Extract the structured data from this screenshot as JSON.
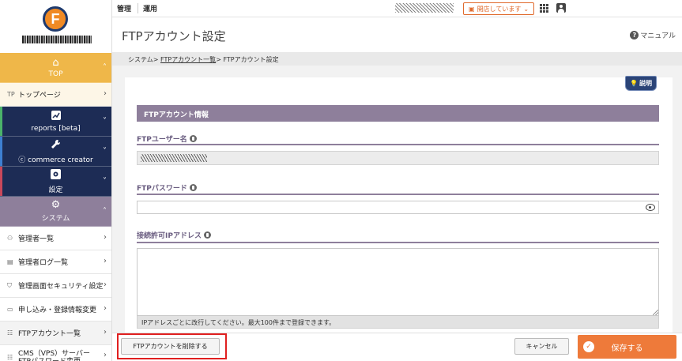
{
  "topbar": {
    "menu": [
      "管理",
      "運用"
    ],
    "shop_status": "開店しています",
    "chevron": "⌄"
  },
  "sidebar": {
    "top": {
      "label": "TOP",
      "icon": "home-icon"
    },
    "top_page": {
      "prefix": "TP",
      "label": "トップページ"
    },
    "reports": {
      "label": "reports [beta]",
      "icon": "chart-icon"
    },
    "commerce_creator": {
      "label": "commerce creator",
      "icon": "wrench-icon"
    },
    "settings": {
      "label": "設定",
      "icon": "settings-icon"
    },
    "system": {
      "label": "システム",
      "icon": "gear-icon"
    },
    "system_items": [
      {
        "label": "管理者一覧",
        "icon": "users-icon"
      },
      {
        "label": "管理者ログ一覧",
        "icon": "log-icon"
      },
      {
        "label": "管理画面セキュリティ設定",
        "icon": "shield-icon"
      },
      {
        "label": "申し込み・登録情報変更",
        "icon": "card-icon"
      },
      {
        "label": "FTPアカウント一覧",
        "icon": "server-icon"
      },
      {
        "label": "CMS（VPS）サーバー FTPパスワード変更",
        "icon": "server-icon"
      }
    ]
  },
  "header": {
    "title": "FTPアカウント設定",
    "manual": "マニュアル"
  },
  "breadcrumb": {
    "root": "システム",
    "sep": ">",
    "link": "FTPアカウント一覧",
    "current": "FTPアカウント設定"
  },
  "form": {
    "help_label": "説明",
    "section_title": "FTPアカウント情報",
    "username_label": "FTPユーザー名",
    "password_label": "FTPパスワード",
    "ip_label": "接続許可IPアドレス",
    "ip_hint": "IPアドレスごとに改行してください。最大100件まで登録できます。"
  },
  "footer": {
    "delete": "FTPアカウントを削除する",
    "cancel": "キャンセル",
    "save": "保存する"
  },
  "colors": {
    "top_nav": "#efb749",
    "navy_nav": "#1d2c55",
    "system_nav": "#8e7f9b",
    "save_button": "#ee7a3a",
    "highlight": "#e02020"
  }
}
